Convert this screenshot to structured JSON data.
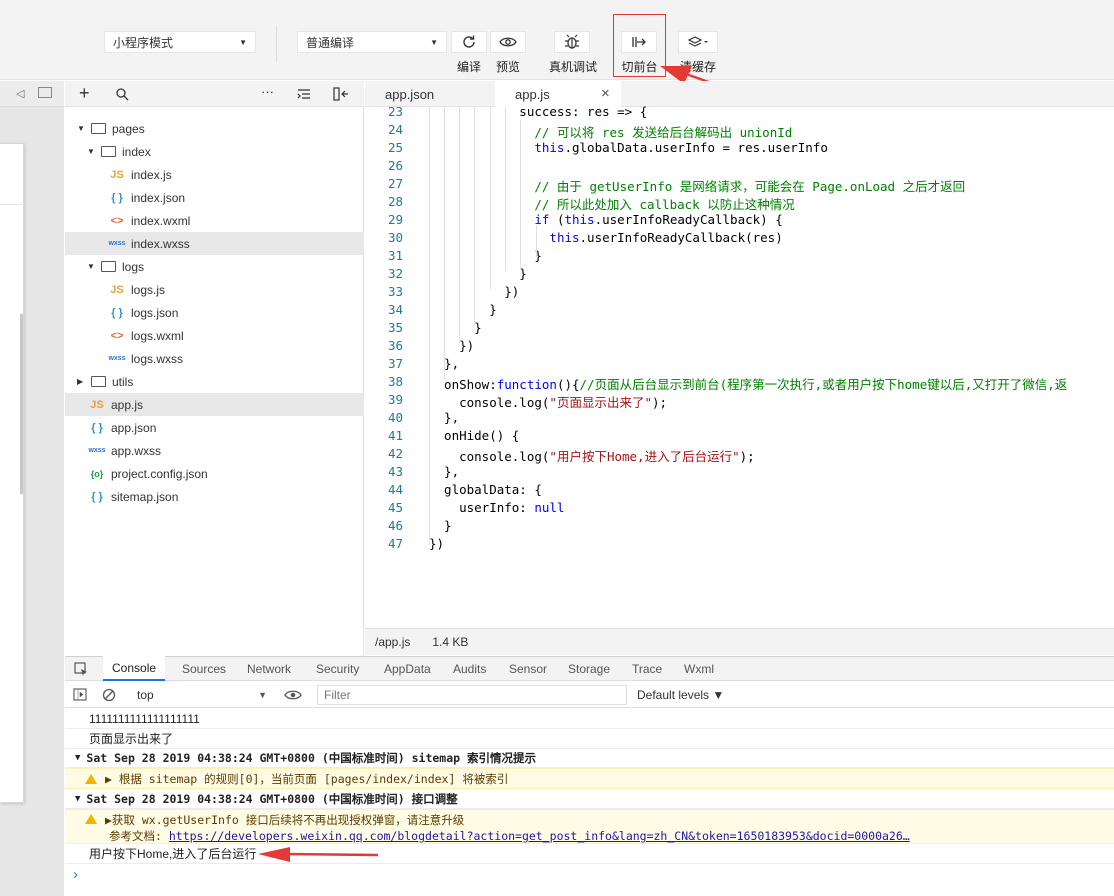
{
  "toolbar": {
    "mode_select": "小程序模式",
    "compile_select": "普通编译",
    "compile_label": "编译",
    "preview_label": "预览",
    "remote_debug_label": "真机调试",
    "switch_bg_label": "切前台",
    "clear_cache_label": "清缓存"
  },
  "explorer": {
    "items": [
      {
        "name": "pages",
        "type": "folder"
      },
      {
        "name": "index",
        "type": "folder"
      },
      {
        "name": "index.js",
        "type": "js",
        "icon": "JS"
      },
      {
        "name": "index.json",
        "type": "json",
        "icon": "{ }"
      },
      {
        "name": "index.wxml",
        "type": "wxml",
        "icon": "<>"
      },
      {
        "name": "index.wxss",
        "type": "wxss",
        "icon": "wxss"
      },
      {
        "name": "logs",
        "type": "folder"
      },
      {
        "name": "logs.js",
        "type": "js",
        "icon": "JS"
      },
      {
        "name": "logs.json",
        "type": "json",
        "icon": "{ }"
      },
      {
        "name": "logs.wxml",
        "type": "wxml",
        "icon": "<>"
      },
      {
        "name": "logs.wxss",
        "type": "wxss",
        "icon": "wxss"
      },
      {
        "name": "utils",
        "type": "folder"
      },
      {
        "name": "app.js",
        "type": "js",
        "icon": "JS"
      },
      {
        "name": "app.json",
        "type": "json",
        "icon": "{ }"
      },
      {
        "name": "app.wxss",
        "type": "wxss",
        "icon": "wxss"
      },
      {
        "name": "project.config.json",
        "type": "cfg",
        "icon": "{o}"
      },
      {
        "name": "sitemap.json",
        "type": "json",
        "icon": "{ }"
      }
    ]
  },
  "editor": {
    "tabs": [
      {
        "label": "app.json"
      },
      {
        "label": "app.js",
        "close": "×"
      }
    ],
    "lines": [
      {
        "n": "23",
        "text": "            success: res => {"
      },
      {
        "n": "24",
        "text": "              // 可以将 res 发送给后台解码出 unionId"
      },
      {
        "n": "25",
        "text": "              this.globalData.userInfo = res.userInfo"
      },
      {
        "n": "26",
        "text": ""
      },
      {
        "n": "27",
        "text": "              // 由于 getUserInfo 是网络请求，可能会在 Page.onLoad 之后才返回"
      },
      {
        "n": "28",
        "text": "              // 所以此处加入 callback 以防止这种情况"
      },
      {
        "n": "29",
        "text": "              if (this.userInfoReadyCallback) {"
      },
      {
        "n": "30",
        "text": "                this.userInfoReadyCallback(res)"
      },
      {
        "n": "31",
        "text": "              }"
      },
      {
        "n": "32",
        "text": "            }"
      },
      {
        "n": "33",
        "text": "          })"
      },
      {
        "n": "34",
        "text": "        }"
      },
      {
        "n": "35",
        "text": "      }"
      },
      {
        "n": "36",
        "text": "    })"
      },
      {
        "n": "37",
        "text": "  },"
      },
      {
        "n": "38",
        "text": "  onShow:function(){//页面从后台显示到前台(程序第一次执行,或者用户按下home键以后,又打开了微信,返"
      },
      {
        "n": "39",
        "text": "    console.log(\"页面显示出来了\");"
      },
      {
        "n": "40",
        "text": "  },"
      },
      {
        "n": "41",
        "text": "  onHide() {"
      },
      {
        "n": "42",
        "text": "    console.log(\"用户按下Home,进入了后台运行\");"
      },
      {
        "n": "43",
        "text": "  },"
      },
      {
        "n": "44",
        "text": "  globalData: {"
      },
      {
        "n": "45",
        "text": "    userInfo: null"
      },
      {
        "n": "46",
        "text": "  }"
      },
      {
        "n": "47",
        "text": "})"
      }
    ],
    "status_path": "/app.js",
    "status_size": "1.4 KB"
  },
  "devtools": {
    "tabs": [
      "Console",
      "Sources",
      "Network",
      "Security",
      "AppData",
      "Audits",
      "Sensor",
      "Storage",
      "Trace",
      "Wxml"
    ],
    "context": "top",
    "filter_placeholder": "Filter",
    "levels": "Default levels ▼",
    "console": {
      "line1": "1111111111111111111",
      "line2": "页面显示出来了",
      "group1": "Sat Sep 28 2019 04:38:24 GMT+0800 (中国标准时间) sitemap 索引情况提示",
      "warn1": "▶ 根据 sitemap 的规则[0]，当前页面 [pages/index/index] 将被索引",
      "group2": "Sat Sep 28 2019 04:38:24 GMT+0800 (中国标准时间) 接口调整",
      "warn2a": "▶获取 wx.getUserInfo 接口后续将不再出现授权弹窗，请注意升级",
      "warn2b_prefix": "参考文档: ",
      "warn2b_link": "https://developers.weixin.qq.com/blogdetail?action=get_post_info&lang=zh_CN&token=1650183953&docid=0000a26…",
      "line3": "用户按下Home,进入了后台运行",
      "prompt": "›"
    }
  },
  "colors": {
    "highlight": "#e53935",
    "keyword": "#0000ff",
    "comment": "#008000",
    "string": "#a31515",
    "line_number": "#237893"
  }
}
